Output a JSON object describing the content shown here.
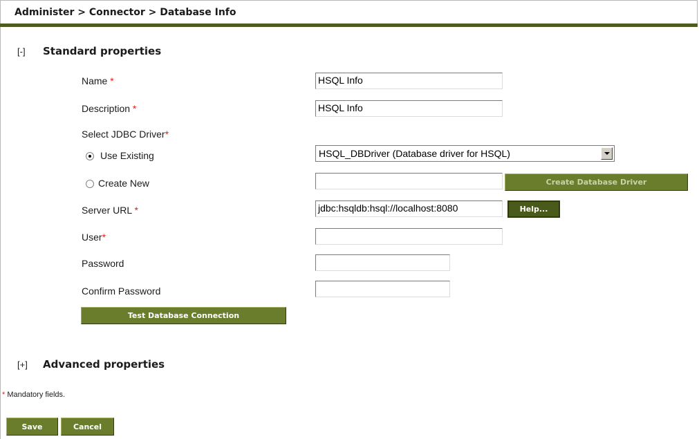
{
  "breadcrumb": "Administer > Connector > Database Info",
  "standard": {
    "toggle": "[-]",
    "title": "Standard properties"
  },
  "fields": {
    "name": {
      "label": "Name",
      "value": "HSQL Info"
    },
    "description": {
      "label": "Description",
      "value": "HSQL Info"
    },
    "jdbc": {
      "label": "Select JDBC Driver",
      "use_existing": "Use Existing",
      "create_new": "Create New",
      "selected_driver": "HSQL_DBDriver (Database driver for HSQL)",
      "new_driver_value": ""
    },
    "server_url": {
      "label": "Server URL",
      "value": "jdbc:hsqldb:hsql://localhost:8080"
    },
    "user": {
      "label": "User",
      "value": ""
    },
    "password": {
      "label": "Password",
      "value": ""
    },
    "confirm_password": {
      "label": "Confirm Password",
      "value": ""
    }
  },
  "required_marker": "*",
  "buttons": {
    "create_driver": "Create Database Driver",
    "help": "Help...",
    "test_connection": "Test Database Connection",
    "save": "Save",
    "cancel": "Cancel"
  },
  "advanced": {
    "toggle": "[+]",
    "title": "Advanced properties"
  },
  "mandatory_note": "Mandatory fields.",
  "colors": {
    "accent": "#697d2c",
    "rule": "#4f5c1f",
    "required": "#e0231b"
  }
}
